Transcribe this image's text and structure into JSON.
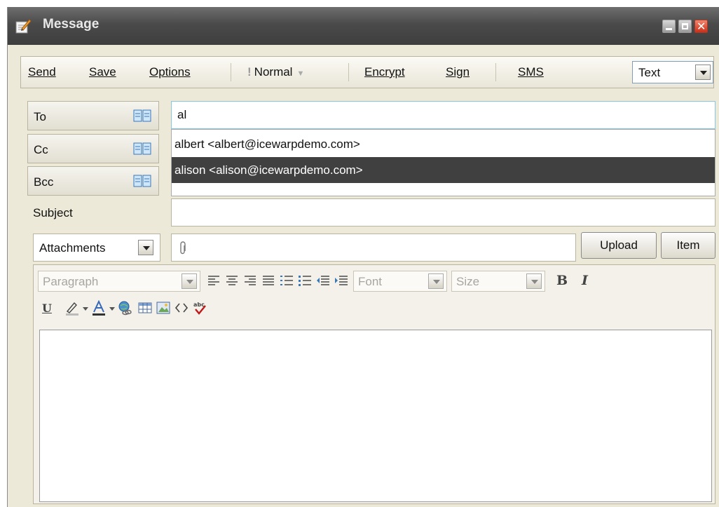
{
  "window": {
    "title": "Message"
  },
  "toolbar": {
    "send": "Send",
    "save": "Save",
    "options": "Options",
    "priority": "Normal",
    "encrypt": "Encrypt",
    "sign": "Sign",
    "sms": "SMS",
    "format": "Text"
  },
  "fields": {
    "to_label": "To",
    "cc_label": "Cc",
    "bcc_label": "Bcc",
    "subject_label": "Subject",
    "to_value": "al",
    "subject_value": "",
    "attachments_label": "Attachments"
  },
  "suggestions": [
    {
      "text": "albert <albert@icewarpdemo.com>",
      "selected": false
    },
    {
      "text": "alison <alison@icewarpdemo.com>",
      "selected": true
    }
  ],
  "buttons": {
    "upload": "Upload",
    "item": "Item"
  },
  "editor": {
    "paragraph": "Paragraph",
    "font": "Font",
    "size": "Size",
    "bold": "B",
    "italic": "I",
    "underline": "U",
    "spell": "abc"
  },
  "colors": {
    "titlebar": "#4a4a4a",
    "selected_suggestion": "#404040",
    "to_field_border": "#86c8e4",
    "close_button": "#c9301a"
  },
  "icons": [
    "compose-icon",
    "minimize-icon",
    "maximize-icon",
    "close-icon",
    "address-book-icon",
    "paperclip-icon"
  ]
}
